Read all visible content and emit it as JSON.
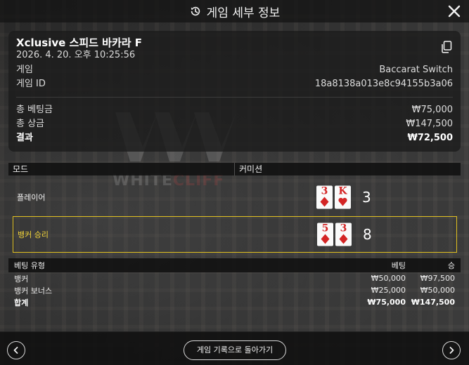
{
  "header": {
    "title": "게임 세부 정보"
  },
  "summary": {
    "game_name": "Xclusive 스피드 바카라 F",
    "date": "2026. 4. 20. 오후 10:25:56",
    "game_label": "게임",
    "game_value": "Baccarat Switch",
    "game_id_label": "게임 ID",
    "game_id_value": "18a8138a013e8c94155b3a06",
    "total_bet_label": "총 베팅금",
    "total_bet_value": "₩75,000",
    "total_win_label": "총 상금",
    "total_win_value": "₩147,500",
    "result_label": "결과",
    "result_value": "₩72,500"
  },
  "mode": {
    "left": "모드",
    "right": "커미션"
  },
  "outcomes": {
    "player": {
      "label": "플레이어",
      "cards": [
        {
          "rank": "3",
          "suit": "diamond"
        },
        {
          "rank": "K",
          "suit": "heart"
        }
      ],
      "score": "3"
    },
    "banker": {
      "label": "뱅커 승리",
      "cards": [
        {
          "rank": "5",
          "suit": "diamond"
        },
        {
          "rank": "3",
          "suit": "diamond"
        }
      ],
      "score": "8"
    }
  },
  "bets": {
    "headers": {
      "type": "베팅 유형",
      "bet": "베팅",
      "win": "승"
    },
    "rows": [
      {
        "type": "뱅커",
        "bet": "₩50,000",
        "win": "₩97,500"
      },
      {
        "type": "뱅커 보너스",
        "bet": "₩25,000",
        "win": "₩50,000"
      }
    ],
    "total": {
      "type": "합계",
      "bet": "₩75,000",
      "win": "₩147,500"
    }
  },
  "footer": {
    "back_label": "게임 기록으로 돌아가기"
  },
  "colors": {
    "highlight": "#e0c020",
    "card_red": "#d42525"
  },
  "icons": [
    "history-icon",
    "close-icon",
    "copy-icon",
    "chevron-left-icon",
    "chevron-right-icon"
  ]
}
